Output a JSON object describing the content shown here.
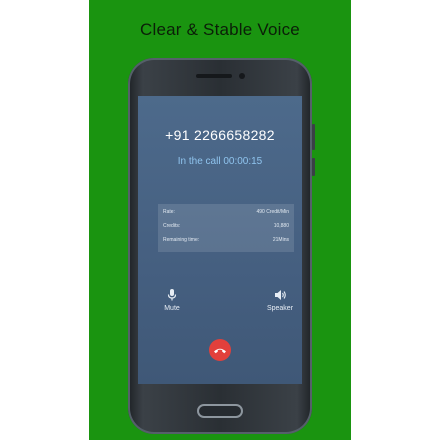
{
  "banner": {
    "headline": "Clear & Stable Voice",
    "background_color": "#1a9410"
  },
  "call_screen": {
    "phone_number": "+91 2266658282",
    "status": "In the call 00:00:15",
    "info": [
      {
        "label": "Rate:",
        "value": "490 Credit/Min"
      },
      {
        "label": "Credits:",
        "value": "10,880"
      },
      {
        "label": "Remaining time:",
        "value": "21Mins"
      }
    ],
    "controls": {
      "mute_label": "Mute",
      "speaker_label": "Speaker"
    },
    "end_call_color": "#e2403b",
    "icons": [
      "microphone-icon",
      "speaker-icon",
      "end-call-icon"
    ]
  }
}
